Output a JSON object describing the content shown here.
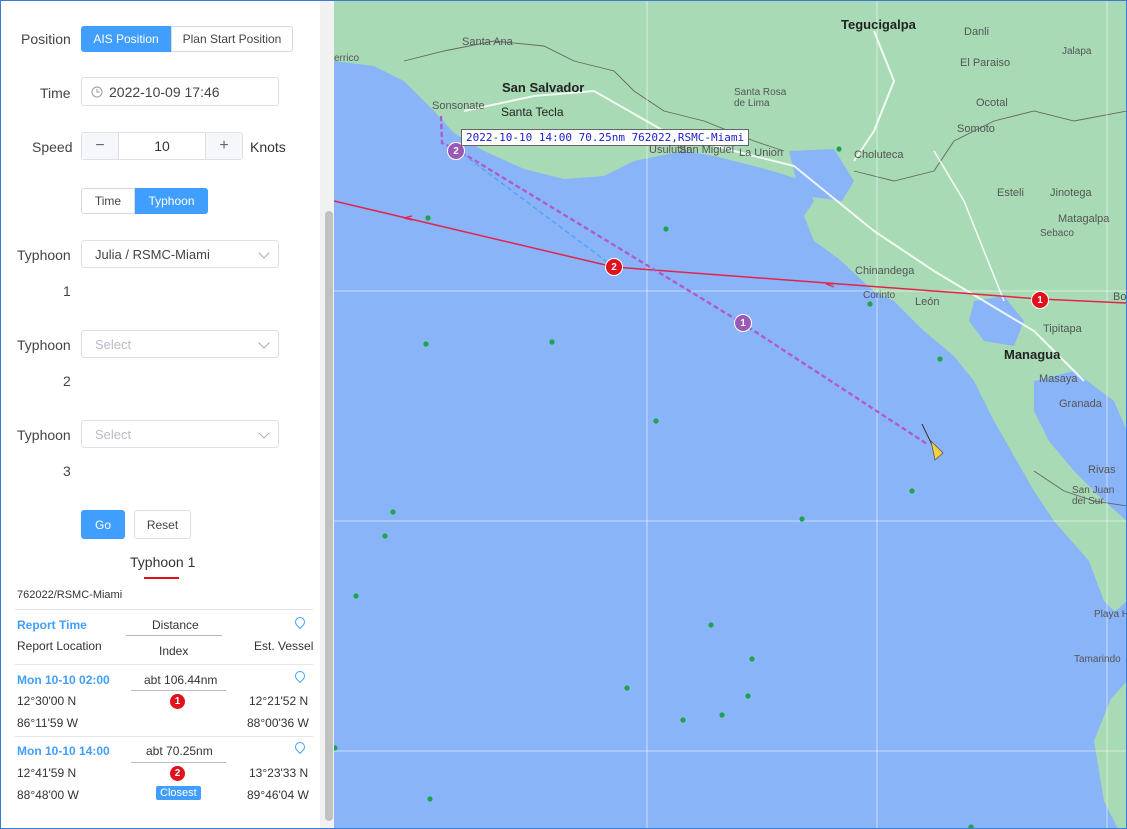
{
  "form": {
    "position_label": "Position",
    "position_options": [
      "AIS Position",
      "Plan Start Position"
    ],
    "time_label": "Time",
    "time_value": "2022-10-09 17:46",
    "speed_label": "Speed",
    "speed_value": "10",
    "speed_unit": "Knots",
    "mode_options": [
      "Time",
      "Typhoon"
    ],
    "typhoon_label": "Typhoon",
    "typhoons": [
      {
        "index": "1",
        "value": "Julia / RSMC-Miami"
      },
      {
        "index": "2",
        "placeholder": "Select"
      },
      {
        "index": "3",
        "placeholder": "Select"
      }
    ],
    "go_label": "Go",
    "reset_label": "Reset"
  },
  "result": {
    "tab": "Typhoon 1",
    "source": "762022/RSMC-Miami",
    "headers": {
      "report_time": "Report Time",
      "distance": "Distance",
      "report_location": "Report Location",
      "index": "Index",
      "est_vessel": "Est. Vessel"
    },
    "rows": [
      {
        "time": "Mon 10-10 02:00",
        "distance": "abt 106.44nm",
        "lat": "12°30'00 N",
        "lon": "86°11'59 W",
        "index": "1",
        "vessel_lat": "12°21'52 N",
        "vessel_lon": "88°00'36 W"
      },
      {
        "time": "Mon 10-10 14:00",
        "distance": "abt 70.25nm",
        "lat": "12°41'59 N",
        "lon": "88°48'00 W",
        "index": "2",
        "badge": "Closest",
        "vessel_lat": "13°23'33 N",
        "vessel_lon": "89°46'04 W"
      }
    ]
  },
  "map": {
    "tooltip": "2022-10-10 14:00 70.25nm 762022,RSMC-Miami",
    "colors": {
      "sea": "#8ab4f8",
      "land": "#a8dab5",
      "typhoon": "#e3234b",
      "route": "#b05cc6"
    },
    "cities": [
      {
        "name": "Tegucigalpa"
      },
      {
        "name": "San Salvador"
      },
      {
        "name": "Santa Tecla"
      },
      {
        "name": "Managua"
      }
    ],
    "places": [
      "Santa Ana",
      "Sonsonate",
      "San Miguel",
      "Usulutan",
      "La Union",
      "Choluteca",
      "Danli",
      "El Paraiso",
      "Ocotal",
      "Somoto",
      "Esteli",
      "Jinotega",
      "Matagalpa",
      "Sebaco",
      "Chinandega",
      "Corinto",
      "León",
      "Tipitapa",
      "Masaya",
      "Granada",
      "Rivas",
      "San Juan del Sur",
      "Playa H",
      "Tamarindo",
      "Jalapa",
      "Santa Rosa de Lima",
      "Bo",
      "errico"
    ],
    "route_markers": [
      "1",
      "2"
    ],
    "typhoon_markers": [
      "1",
      "2"
    ]
  }
}
